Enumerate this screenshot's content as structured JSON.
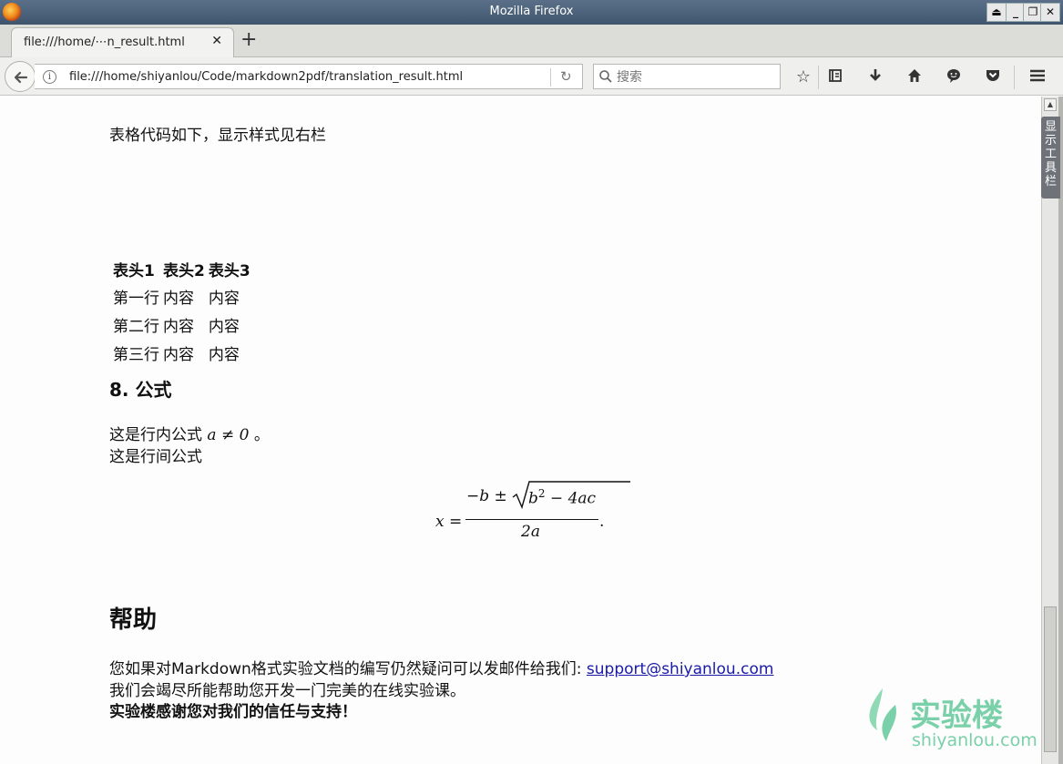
{
  "window": {
    "title": "Mozilla Firefox"
  },
  "tabs": [
    {
      "title": "file:///home/⋯n_result.html"
    }
  ],
  "navbar": {
    "url": "file:///home/shiyanlou/Code/markdown2pdf/translation_result.html",
    "search_placeholder": "搜索"
  },
  "content": {
    "intro": "表格代码如下，显示样式见右栏",
    "table": {
      "headers": [
        "表头1",
        "表头2",
        "表头3"
      ],
      "rows": [
        [
          "第一行",
          "内容",
          "内容"
        ],
        [
          "第二行",
          "内容",
          "内容"
        ],
        [
          "第三行",
          "内容",
          "内容"
        ]
      ]
    },
    "section_heading": "8. 公式",
    "inline_formula_prefix": "这是行内公式",
    "inline_formula": "a ≠ 0",
    "inline_formula_suffix": "。",
    "block_formula_intro": "这是行间公式",
    "formula": {
      "lhs": "x",
      "eq": "=",
      "numerator": "−b ±",
      "radicand_base": "b",
      "radicand_exp": "2",
      "radicand_rest": " − 4ac",
      "denominator": "2a",
      "end": "."
    },
    "help_heading": "帮助",
    "help_line1_text": "您如果对Markdown格式实验文档的编写仍然疑问可以发邮件给我们: ",
    "help_email": "support@shiyanlou.com",
    "help_line2": "我们会竭尽所能帮助您开发一门完美的在线实验课。",
    "help_line3": "实验楼感谢您对我们的信任与支持！"
  },
  "watermark": {
    "brand": "实验楼",
    "domain": "shiyanlou.com"
  },
  "side_toggle": {
    "label": "显示工具栏"
  }
}
